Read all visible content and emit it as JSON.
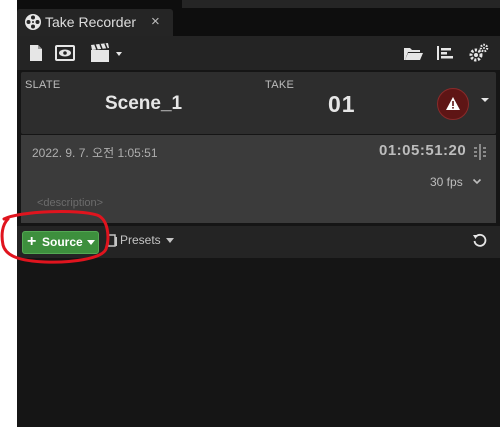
{
  "tab": {
    "title": "Take Recorder",
    "close_glyph": "×"
  },
  "toolbar": {
    "icons": [
      "new-file-icon",
      "review-icon",
      "clapperboard-icon",
      "open-folder-icon",
      "sequence-icon",
      "settings-icon"
    ]
  },
  "slate": {
    "slate_label": "SLATE",
    "slate_value": "Scene_1",
    "take_label": "TAKE",
    "take_value": "01"
  },
  "info": {
    "date": "2022. 9. 7. 오전 1:05:51",
    "timecode": "01:05:51:20",
    "fps": "30 fps",
    "description_placeholder": "<description>"
  },
  "sources_bar": {
    "source_plus": "+",
    "source_label": "Source",
    "presets_label": "Presets"
  },
  "colors": {
    "panel_bg": "#151515",
    "toolbar_bg": "#242424",
    "info_bg": "#3b3b3b",
    "source_green": "#3d8f3d",
    "record_red": "#5e1515",
    "annotation_red": "#e0141e"
  }
}
